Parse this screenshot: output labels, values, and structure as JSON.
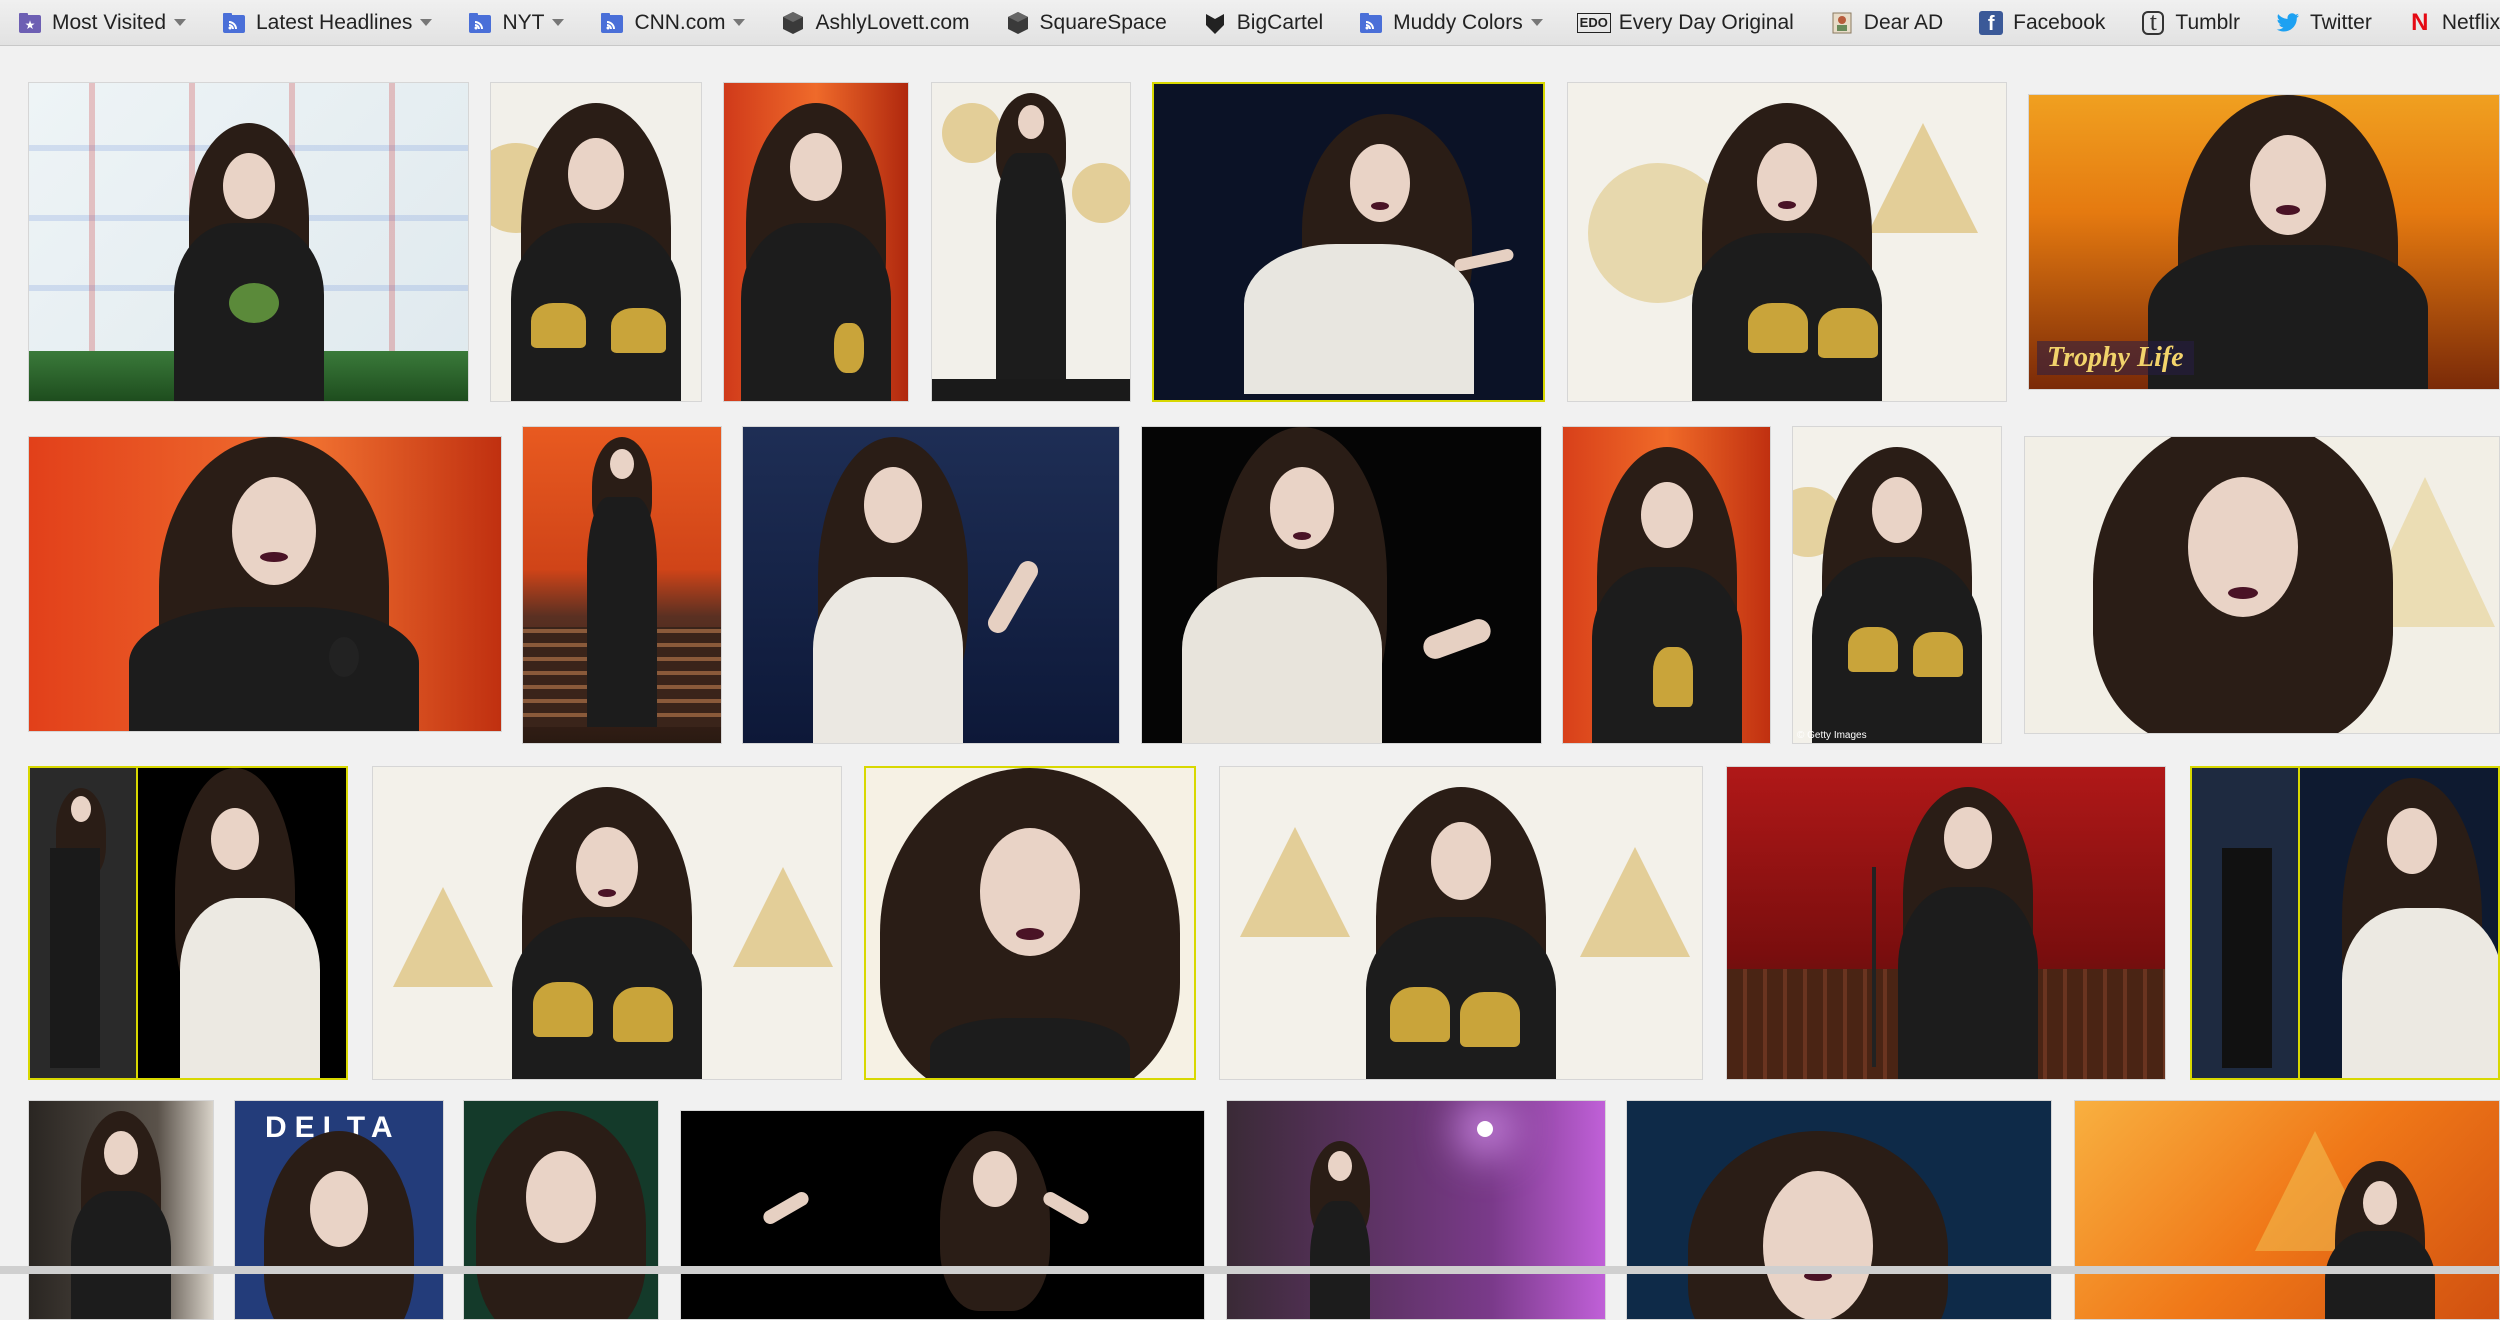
{
  "bookmarks": [
    {
      "label": "Most Visited",
      "icon": "star-folder-icon",
      "dropdown": true
    },
    {
      "label": "Latest Headlines",
      "icon": "rss-feed-icon",
      "dropdown": true
    },
    {
      "label": "NYT",
      "icon": "rss-feed-icon",
      "dropdown": true
    },
    {
      "label": "CNN.com",
      "icon": "rss-feed-icon",
      "dropdown": true
    },
    {
      "label": "AshlyLovett.com",
      "icon": "cube-icon",
      "dropdown": false
    },
    {
      "label": "SquareSpace",
      "icon": "cube-icon",
      "dropdown": false
    },
    {
      "label": "BigCartel",
      "icon": "bigcartel-icon",
      "dropdown": false
    },
    {
      "label": "Muddy Colors",
      "icon": "rss-feed-icon",
      "dropdown": true
    },
    {
      "label": "Every Day Original",
      "icon": "edo-icon",
      "dropdown": false
    },
    {
      "label": "Dear AD",
      "icon": "dear-ad-icon",
      "dropdown": false
    },
    {
      "label": "Facebook",
      "icon": "facebook-icon",
      "dropdown": false
    },
    {
      "label": "Tumblr",
      "icon": "tumblr-icon",
      "dropdown": false
    },
    {
      "label": "Twitter",
      "icon": "twitter-icon",
      "dropdown": false
    },
    {
      "label": "Netflix",
      "icon": "netflix-icon",
      "dropdown": false
    }
  ],
  "icon_text": {
    "edo": "EDO",
    "facebook": "f",
    "tumblr": "t",
    "netflix": "N"
  },
  "image_captions": {
    "trophy_life": "Trophy Life",
    "getty": "© Getty Images",
    "delta": "DELTA"
  },
  "colors": {
    "highlight_border": "#d8d800",
    "rss_blue": "#4a6fd8",
    "facebook_blue": "#3b5998",
    "twitter_blue": "#1da1f2",
    "netflix_red": "#e50914"
  }
}
